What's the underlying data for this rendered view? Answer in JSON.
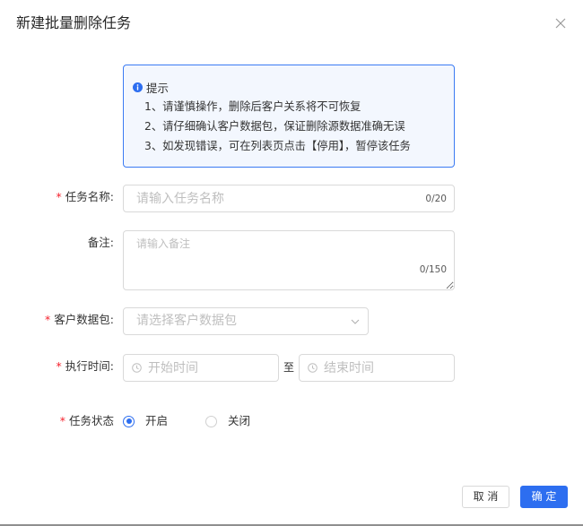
{
  "dialog": {
    "title": "新建批量删除任务",
    "close_icon": "close-icon"
  },
  "notice": {
    "icon": "info-icon",
    "title": "提示",
    "lines": [
      "1、请谨慎操作，删除后客户关系将不可恢复",
      "2、请仔细确认客户数据包，保证删除源数据准确无误",
      "3、如发现错误，可在列表页点击【停用】，暂停该任务"
    ]
  },
  "form": {
    "required_mark": "*",
    "task_name": {
      "label": "任务名称:",
      "required": true,
      "value": "",
      "placeholder": "请输入任务名称",
      "counter": "0/20"
    },
    "remark": {
      "label": "备注:",
      "required": false,
      "value": "",
      "placeholder": "请输入备注",
      "counter": "0/150"
    },
    "data_package": {
      "label": "客户数据包:",
      "required": true,
      "placeholder": "请选择客户数据包",
      "icon": "chevron-down-icon"
    },
    "exec_time": {
      "label": "执行时间:",
      "required": true,
      "start_value": "",
      "start_placeholder": "开始时间",
      "separator": "至",
      "end_value": "",
      "end_placeholder": "结束时间",
      "icon": "clock-icon"
    },
    "task_status": {
      "label": "任务状态",
      "required": true,
      "options": [
        {
          "label": "开启",
          "checked": true
        },
        {
          "label": "关闭",
          "checked": false
        }
      ]
    }
  },
  "footer": {
    "cancel_label": "取 消",
    "confirm_label": "确 定"
  },
  "colors": {
    "primary": "#2d6ef0",
    "required": "#f5222d",
    "notice_border": "#3b7bf3",
    "notice_bg": "#f3f7fe",
    "text": "#333333",
    "placeholder": "#bfbfbf",
    "border": "#d9d9d9"
  }
}
